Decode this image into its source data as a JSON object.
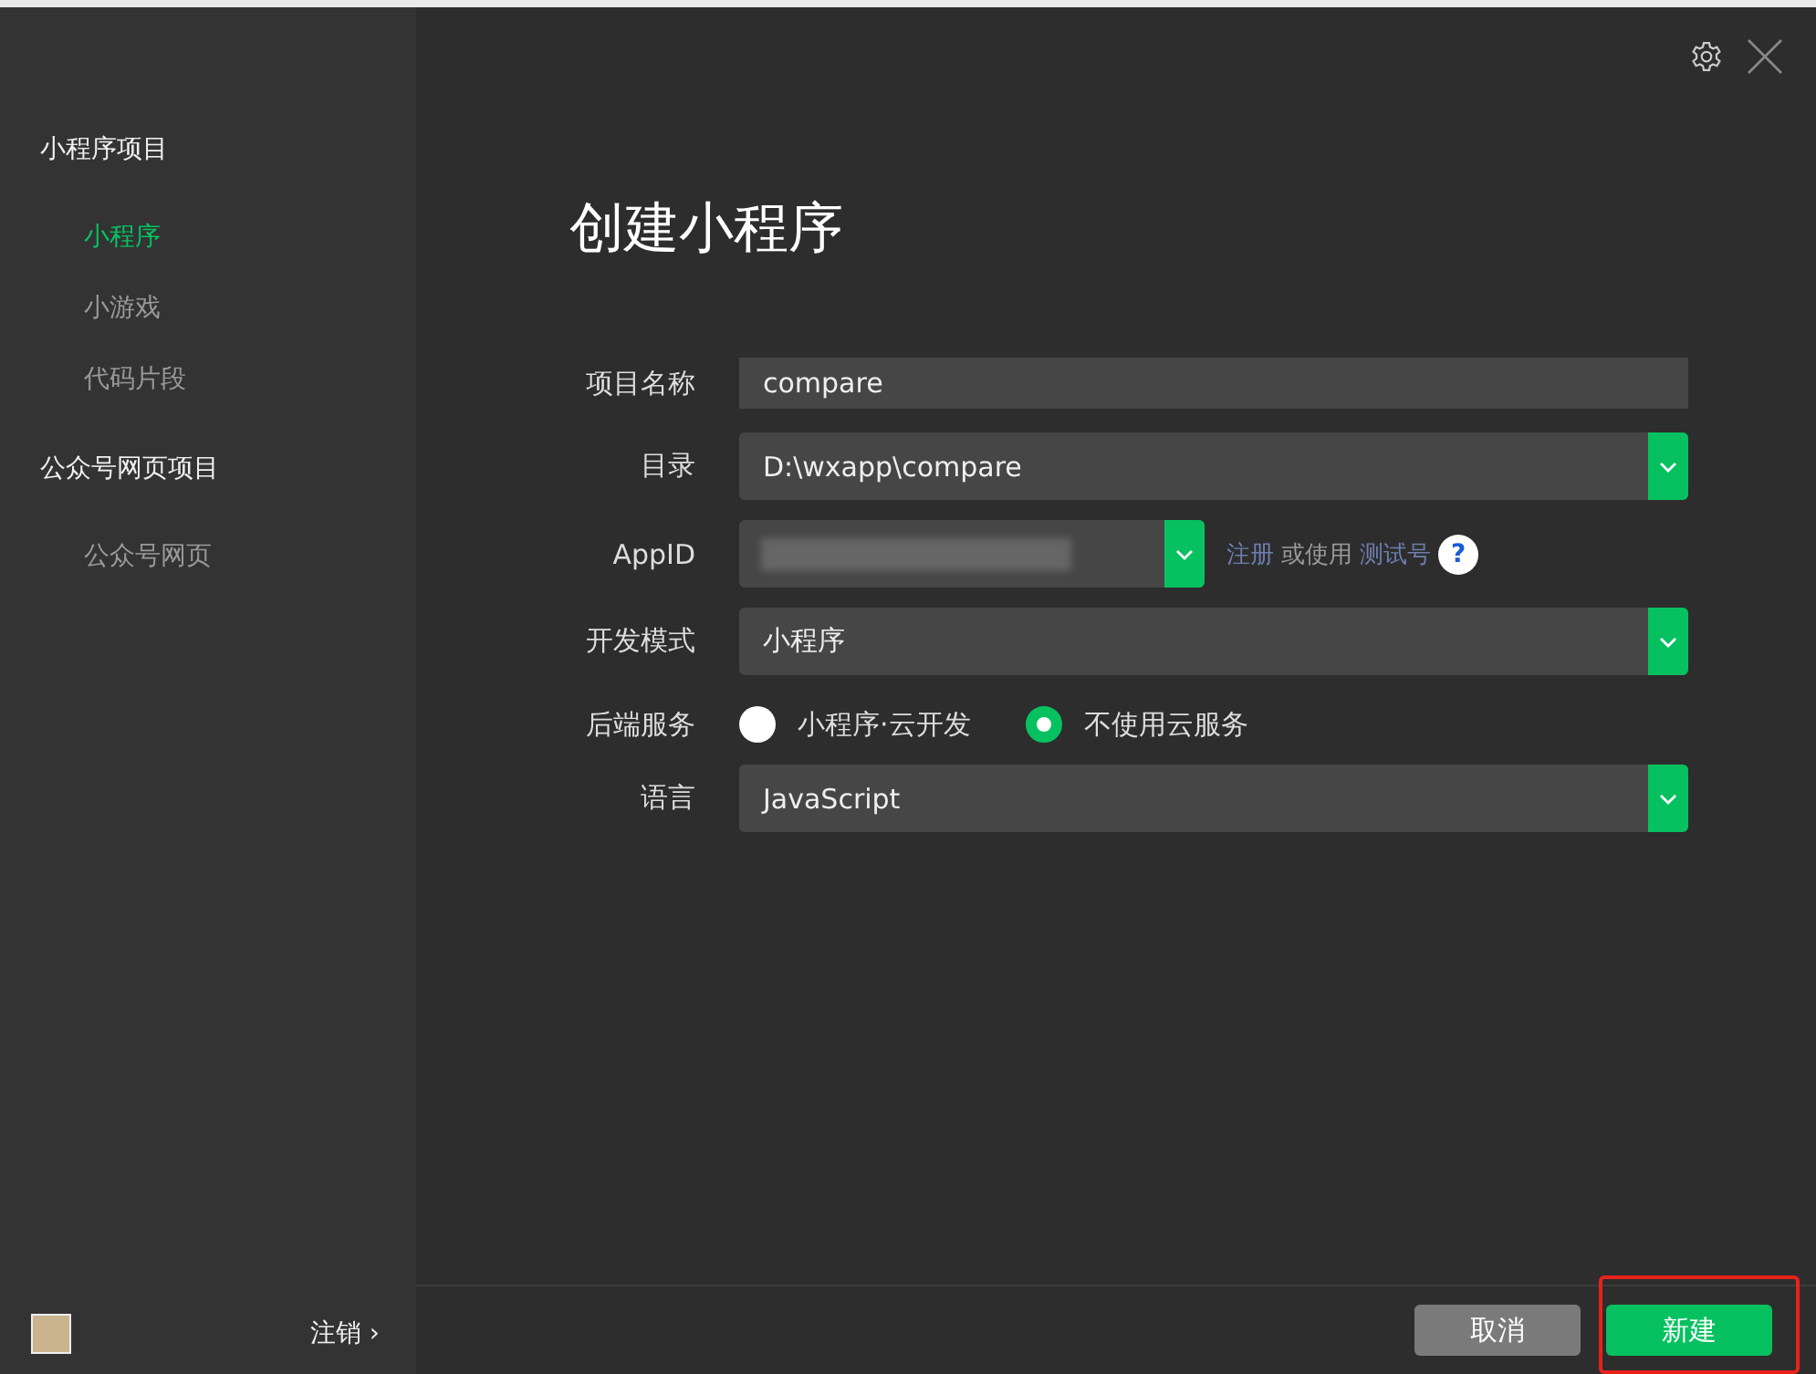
{
  "sidebar": {
    "groups": [
      {
        "title": "小程序项目",
        "items": [
          {
            "label": "小程序",
            "selected": true
          },
          {
            "label": "小游戏",
            "selected": false
          },
          {
            "label": "代码片段",
            "selected": false
          }
        ]
      },
      {
        "title": "公众号网页项目",
        "items": [
          {
            "label": "公众号网页",
            "selected": false
          }
        ]
      }
    ],
    "logout": {
      "label": "注销",
      "chevron": "›"
    }
  },
  "title": "创建小程序",
  "form": [
    {
      "kind": "text",
      "label": "项目名称",
      "value": "compare"
    },
    {
      "kind": "select",
      "label": "目录",
      "value": "D:\\wxapp\\compare"
    },
    {
      "kind": "appid",
      "label": "AppID",
      "redacted": true,
      "links": [
        {
          "text": "注册",
          "link": true
        },
        {
          "text": "或使用",
          "link": false
        },
        {
          "text": "测试号",
          "link": true
        }
      ],
      "help": "?"
    },
    {
      "kind": "select",
      "label": "开发模式",
      "value": "小程序"
    },
    {
      "kind": "radio",
      "label": "后端服务",
      "options": [
        {
          "label": "小程序·云开发",
          "selected": false
        },
        {
          "label": "不使用云服务",
          "selected": true
        }
      ]
    },
    {
      "kind": "select",
      "label": "语言",
      "value": "JavaScript"
    }
  ],
  "buttons": [
    {
      "label": "取消",
      "kind": "secondary"
    },
    {
      "label": "新建",
      "kind": "primary",
      "highlighted": true
    }
  ]
}
